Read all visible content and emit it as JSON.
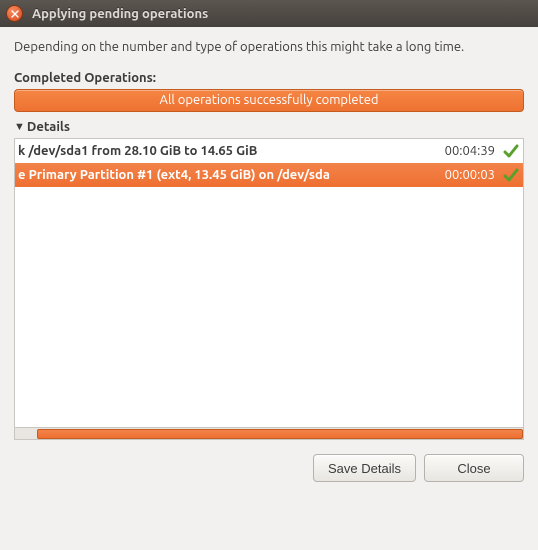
{
  "window": {
    "title": "Applying pending operations"
  },
  "info_text": "Depending on the number and type of operations this might take a long time.",
  "completed_label": "Completed Operations:",
  "status_text": "All operations successfully completed",
  "details": {
    "toggle_label": "Details",
    "expanded": true
  },
  "operations": [
    {
      "desc": "k /dev/sda1 from 28.10 GiB to 14.65 GiB",
      "time": "00:04:39",
      "status": "success",
      "selected": false
    },
    {
      "desc": "e Primary Partition #1 (ext4, 13.45 GiB) on /dev/sda",
      "time": "00:00:03",
      "status": "success",
      "selected": true
    }
  ],
  "buttons": {
    "save": "Save Details",
    "close": "Close"
  }
}
